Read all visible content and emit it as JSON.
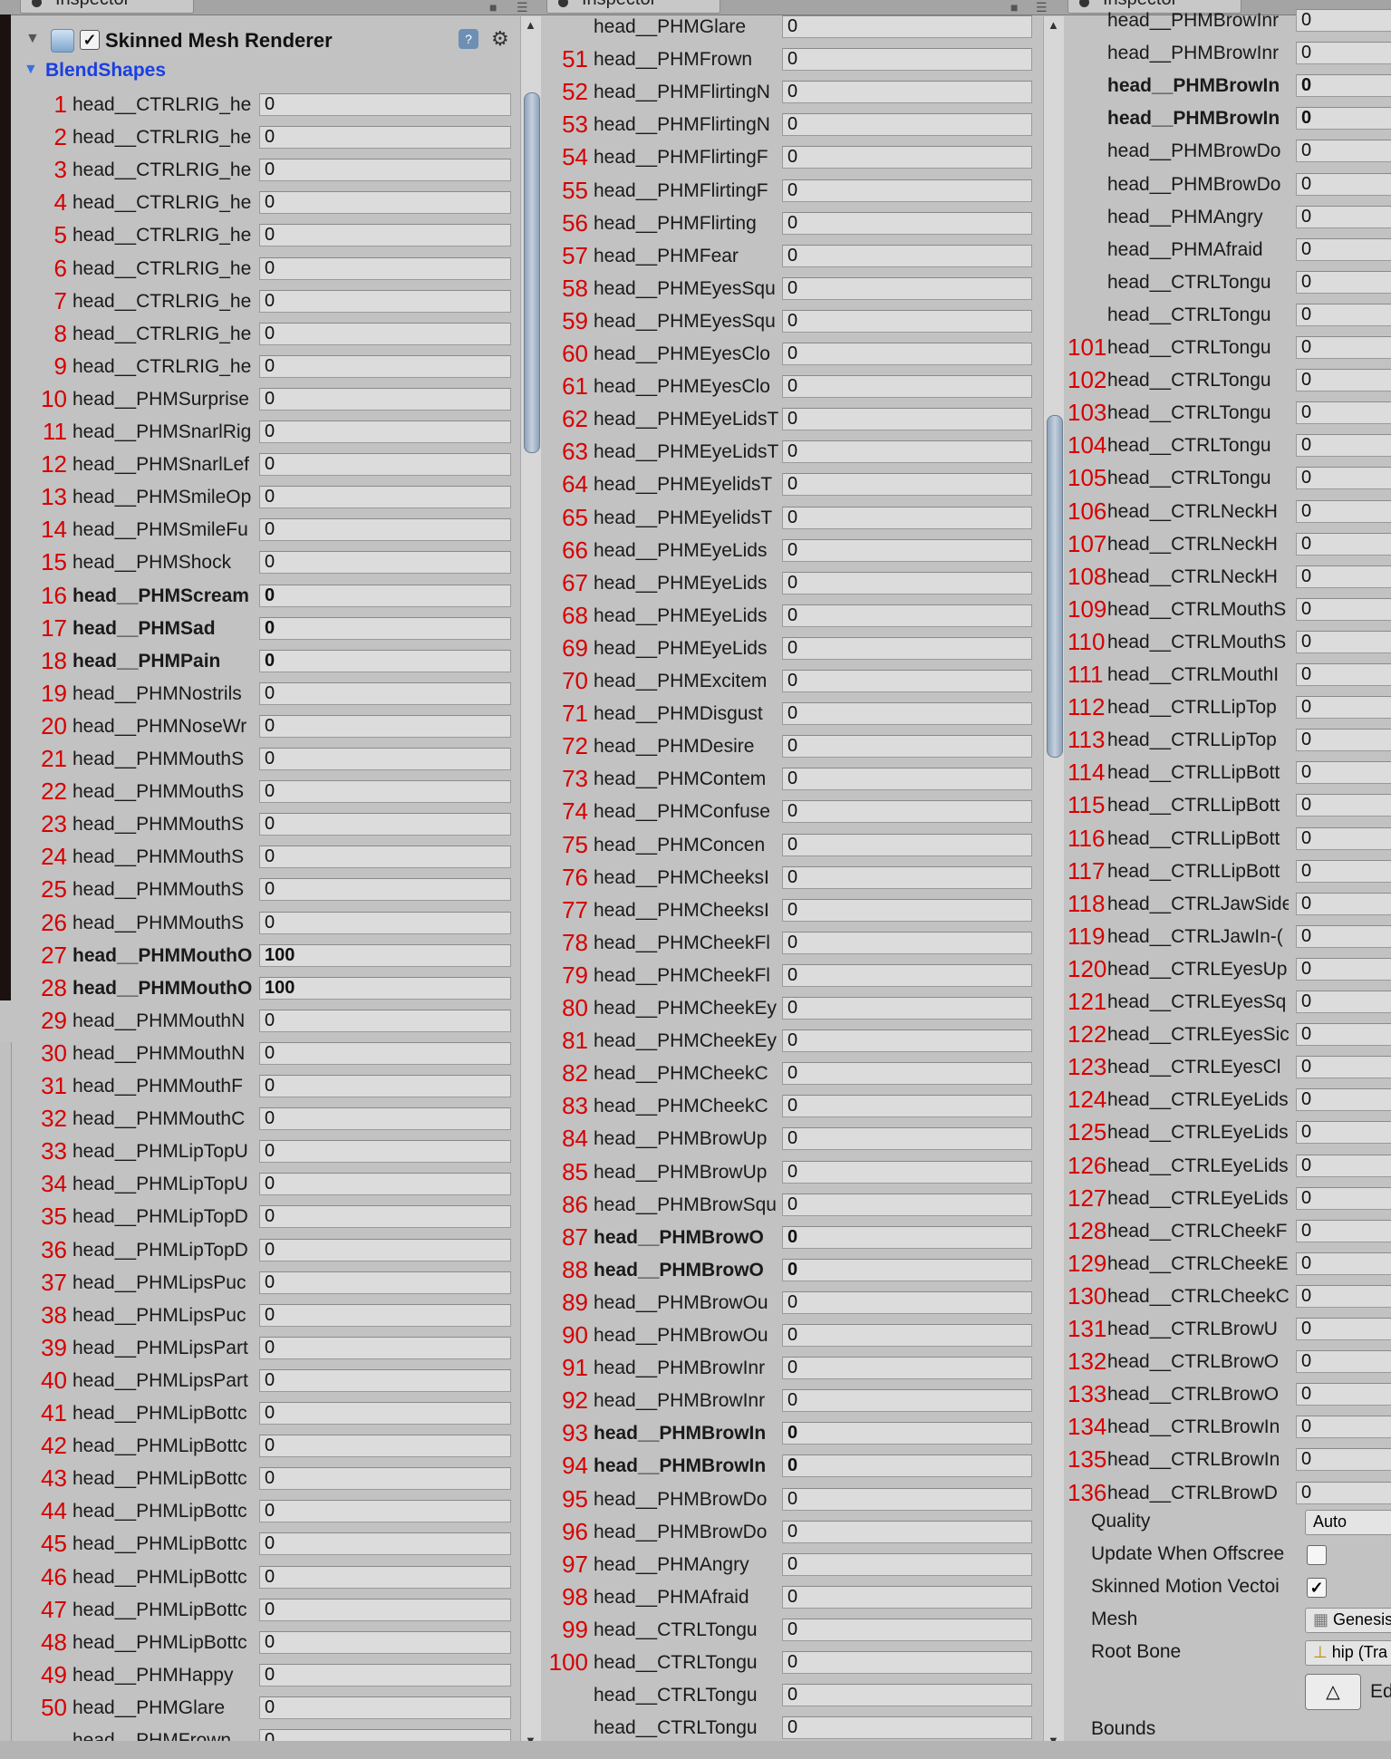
{
  "tabs": [
    "Inspector",
    "Inspector",
    "Inspector"
  ],
  "component": {
    "title": "Skinned Mesh Renderer",
    "enabled": "✓",
    "help": "?",
    "settings": "⚙"
  },
  "blendshapes_label": "BlendShapes",
  "panel1": {
    "rows": [
      {
        "n": "1",
        "label": "head__CTRLRIG_he",
        "value": "0"
      },
      {
        "n": "2",
        "label": "head__CTRLRIG_he",
        "value": "0"
      },
      {
        "n": "3",
        "label": "head__CTRLRIG_he",
        "value": "0"
      },
      {
        "n": "4",
        "label": "head__CTRLRIG_he",
        "value": "0"
      },
      {
        "n": "5",
        "label": "head__CTRLRIG_he",
        "value": "0"
      },
      {
        "n": "6",
        "label": "head__CTRLRIG_he",
        "value": "0"
      },
      {
        "n": "7",
        "label": "head__CTRLRIG_he",
        "value": "0"
      },
      {
        "n": "8",
        "label": "head__CTRLRIG_he",
        "value": "0"
      },
      {
        "n": "9",
        "label": "head__CTRLRIG_he",
        "value": "0"
      },
      {
        "n": "10",
        "label": "head__PHMSurprise",
        "value": "0"
      },
      {
        "n": "11",
        "label": "head__PHMSnarlRig",
        "value": "0"
      },
      {
        "n": "12",
        "label": "head__PHMSnarlLef",
        "value": "0"
      },
      {
        "n": "13",
        "label": "head__PHMSmileOp",
        "value": "0"
      },
      {
        "n": "14",
        "label": "head__PHMSmileFu",
        "value": "0"
      },
      {
        "n": "15",
        "label": "head__PHMShock",
        "value": "0"
      },
      {
        "n": "16",
        "label": "head__PHMScream",
        "value": "0",
        "bold": true
      },
      {
        "n": "17",
        "label": "head__PHMSad",
        "value": "0",
        "bold": true
      },
      {
        "n": "18",
        "label": "head__PHMPain",
        "value": "0",
        "bold": true
      },
      {
        "n": "19",
        "label": "head__PHMNostrils",
        "value": "0"
      },
      {
        "n": "20",
        "label": "head__PHMNoseWr",
        "value": "0"
      },
      {
        "n": "21",
        "label": "head__PHMMouthS",
        "value": "0"
      },
      {
        "n": "22",
        "label": "head__PHMMouthS",
        "value": "0"
      },
      {
        "n": "23",
        "label": "head__PHMMouthS",
        "value": "0"
      },
      {
        "n": "24",
        "label": "head__PHMMouthS",
        "value": "0"
      },
      {
        "n": "25",
        "label": "head__PHMMouthS",
        "value": "0"
      },
      {
        "n": "26",
        "label": "head__PHMMouthS",
        "value": "0"
      },
      {
        "n": "27",
        "label": "head__PHMMouthO",
        "value": "100",
        "bold": true
      },
      {
        "n": "28",
        "label": "head__PHMMouthO",
        "value": "100",
        "bold": true
      },
      {
        "n": "29",
        "label": "head__PHMMouthN",
        "value": "0"
      },
      {
        "n": "30",
        "label": "head__PHMMouthN",
        "value": "0"
      },
      {
        "n": "31",
        "label": "head__PHMMouthF",
        "value": "0"
      },
      {
        "n": "32",
        "label": "head__PHMMouthC",
        "value": "0"
      },
      {
        "n": "33",
        "label": "head__PHMLipTopU",
        "value": "0"
      },
      {
        "n": "34",
        "label": "head__PHMLipTopU",
        "value": "0"
      },
      {
        "n": "35",
        "label": "head__PHMLipTopD",
        "value": "0"
      },
      {
        "n": "36",
        "label": "head__PHMLipTopD",
        "value": "0"
      },
      {
        "n": "37",
        "label": "head__PHMLipsPuc",
        "value": "0"
      },
      {
        "n": "38",
        "label": "head__PHMLipsPuc",
        "value": "0"
      },
      {
        "n": "39",
        "label": "head__PHMLipsPart",
        "value": "0"
      },
      {
        "n": "40",
        "label": "head__PHMLipsPart",
        "value": "0"
      },
      {
        "n": "41",
        "label": "head__PHMLipBottc",
        "value": "0"
      },
      {
        "n": "42",
        "label": "head__PHMLipBottc",
        "value": "0"
      },
      {
        "n": "43",
        "label": "head__PHMLipBottc",
        "value": "0"
      },
      {
        "n": "44",
        "label": "head__PHMLipBottc",
        "value": "0"
      },
      {
        "n": "45",
        "label": "head__PHMLipBottc",
        "value": "0"
      },
      {
        "n": "46",
        "label": "head__PHMLipBottc",
        "value": "0"
      },
      {
        "n": "47",
        "label": "head__PHMLipBottc",
        "value": "0"
      },
      {
        "n": "48",
        "label": "head__PHMLipBottc",
        "value": "0"
      },
      {
        "n": "49",
        "label": "head__PHMHappy",
        "value": "0"
      },
      {
        "n": "50",
        "label": "head__PHMGlare",
        "value": "0"
      },
      {
        "n": "",
        "label": "head__PHMFrown",
        "value": "0"
      }
    ]
  },
  "panel2": {
    "rows": [
      {
        "n": "",
        "label": "head__PHMGlare",
        "value": "0"
      },
      {
        "n": "51",
        "label": "head__PHMFrown",
        "value": "0"
      },
      {
        "n": "52",
        "label": "head__PHMFlirtingN",
        "value": "0"
      },
      {
        "n": "53",
        "label": "head__PHMFlirtingN",
        "value": "0"
      },
      {
        "n": "54",
        "label": "head__PHMFlirtingF",
        "value": "0"
      },
      {
        "n": "55",
        "label": "head__PHMFlirtingF",
        "value": "0"
      },
      {
        "n": "56",
        "label": "head__PHMFlirting",
        "value": "0"
      },
      {
        "n": "57",
        "label": "head__PHMFear",
        "value": "0"
      },
      {
        "n": "58",
        "label": "head__PHMEyesSqu",
        "value": "0"
      },
      {
        "n": "59",
        "label": "head__PHMEyesSqu",
        "value": "0"
      },
      {
        "n": "60",
        "label": "head__PHMEyesClo",
        "value": "0"
      },
      {
        "n": "61",
        "label": "head__PHMEyesClo",
        "value": "0"
      },
      {
        "n": "62",
        "label": "head__PHMEyeLidsT",
        "value": "0"
      },
      {
        "n": "63",
        "label": "head__PHMEyeLidsT",
        "value": "0"
      },
      {
        "n": "64",
        "label": "head__PHMEyelidsT",
        "value": "0"
      },
      {
        "n": "65",
        "label": "head__PHMEyelidsT",
        "value": "0"
      },
      {
        "n": "66",
        "label": "head__PHMEyeLids",
        "value": "0"
      },
      {
        "n": "67",
        "label": "head__PHMEyeLids",
        "value": "0"
      },
      {
        "n": "68",
        "label": "head__PHMEyeLids",
        "value": "0"
      },
      {
        "n": "69",
        "label": "head__PHMEyeLids",
        "value": "0"
      },
      {
        "n": "70",
        "label": "head__PHMExcitem",
        "value": "0"
      },
      {
        "n": "71",
        "label": "head__PHMDisgust",
        "value": "0"
      },
      {
        "n": "72",
        "label": "head__PHMDesire",
        "value": "0"
      },
      {
        "n": "73",
        "label": "head__PHMContem",
        "value": "0"
      },
      {
        "n": "74",
        "label": "head__PHMConfuse",
        "value": "0"
      },
      {
        "n": "75",
        "label": "head__PHMConcen",
        "value": "0"
      },
      {
        "n": "76",
        "label": "head__PHMCheeksI",
        "value": "0"
      },
      {
        "n": "77",
        "label": "head__PHMCheeksI",
        "value": "0"
      },
      {
        "n": "78",
        "label": "head__PHMCheekFl",
        "value": "0"
      },
      {
        "n": "79",
        "label": "head__PHMCheekFl",
        "value": "0"
      },
      {
        "n": "80",
        "label": "head__PHMCheekEy",
        "value": "0"
      },
      {
        "n": "81",
        "label": "head__PHMCheekEy",
        "value": "0"
      },
      {
        "n": "82",
        "label": "head__PHMCheekC",
        "value": "0"
      },
      {
        "n": "83",
        "label": "head__PHMCheekC",
        "value": "0"
      },
      {
        "n": "84",
        "label": "head__PHMBrowUp",
        "value": "0"
      },
      {
        "n": "85",
        "label": "head__PHMBrowUp",
        "value": "0"
      },
      {
        "n": "86",
        "label": "head__PHMBrowSqu",
        "value": "0"
      },
      {
        "n": "87",
        "label": "head__PHMBrowO",
        "value": "0",
        "bold": true
      },
      {
        "n": "88",
        "label": "head__PHMBrowO",
        "value": "0",
        "bold": true
      },
      {
        "n": "89",
        "label": "head__PHMBrowOu",
        "value": "0"
      },
      {
        "n": "90",
        "label": "head__PHMBrowOu",
        "value": "0"
      },
      {
        "n": "91",
        "label": "head__PHMBrowInr",
        "value": "0"
      },
      {
        "n": "92",
        "label": "head__PHMBrowInr",
        "value": "0"
      },
      {
        "n": "93",
        "label": "head__PHMBrowIn",
        "value": "0",
        "bold": true
      },
      {
        "n": "94",
        "label": "head__PHMBrowIn",
        "value": "0",
        "bold": true
      },
      {
        "n": "95",
        "label": "head__PHMBrowDo",
        "value": "0"
      },
      {
        "n": "96",
        "label": "head__PHMBrowDo",
        "value": "0"
      },
      {
        "n": "97",
        "label": "head__PHMAngry",
        "value": "0"
      },
      {
        "n": "98",
        "label": "head__PHMAfraid",
        "value": "0"
      },
      {
        "n": "99",
        "label": "head__CTRLTongu",
        "value": "0"
      },
      {
        "n": "100",
        "label": "head__CTRLTongu",
        "value": "0"
      },
      {
        "n": "",
        "label": "head__CTRLTongu",
        "value": "0"
      },
      {
        "n": "",
        "label": "head__CTRLTongu",
        "value": "0"
      }
    ]
  },
  "panel3": {
    "rows": [
      {
        "n": "",
        "label": "head__PHMBrowInr",
        "value": "0"
      },
      {
        "n": "",
        "label": "head__PHMBrowInr",
        "value": "0"
      },
      {
        "n": "",
        "label": "head__PHMBrowIn",
        "value": "0",
        "bold": true
      },
      {
        "n": "",
        "label": "head__PHMBrowIn",
        "value": "0",
        "bold": true
      },
      {
        "n": "",
        "label": "head__PHMBrowDo",
        "value": "0"
      },
      {
        "n": "",
        "label": "head__PHMBrowDo",
        "value": "0"
      },
      {
        "n": "",
        "label": "head__PHMAngry",
        "value": "0"
      },
      {
        "n": "",
        "label": "head__PHMAfraid",
        "value": "0"
      },
      {
        "n": "",
        "label": "head__CTRLTongu",
        "value": "0"
      },
      {
        "n": "",
        "label": "head__CTRLTongu",
        "value": "0"
      },
      {
        "n": "101",
        "label": "head__CTRLTongu",
        "value": "0"
      },
      {
        "n": "102",
        "label": "head__CTRLTongu",
        "value": "0"
      },
      {
        "n": "103",
        "label": "head__CTRLTongu",
        "value": "0"
      },
      {
        "n": "104",
        "label": "head__CTRLTongu",
        "value": "0"
      },
      {
        "n": "105",
        "label": "head__CTRLTongu",
        "value": "0"
      },
      {
        "n": "106",
        "label": "head__CTRLNeckH",
        "value": "0"
      },
      {
        "n": "107",
        "label": "head__CTRLNeckH",
        "value": "0"
      },
      {
        "n": "108",
        "label": "head__CTRLNeckH",
        "value": "0"
      },
      {
        "n": "109",
        "label": "head__CTRLMouthS",
        "value": "0"
      },
      {
        "n": "110",
        "label": "head__CTRLMouthS",
        "value": "0"
      },
      {
        "n": "111",
        "label": "head__CTRLMouthI",
        "value": "0"
      },
      {
        "n": "112",
        "label": "head__CTRLLipTop",
        "value": "0"
      },
      {
        "n": "113",
        "label": "head__CTRLLipTop",
        "value": "0"
      },
      {
        "n": "114",
        "label": "head__CTRLLipBott",
        "value": "0"
      },
      {
        "n": "115",
        "label": "head__CTRLLipBott",
        "value": "0"
      },
      {
        "n": "116",
        "label": "head__CTRLLipBott",
        "value": "0"
      },
      {
        "n": "117",
        "label": "head__CTRLLipBott",
        "value": "0"
      },
      {
        "n": "118",
        "label": "head__CTRLJawSide",
        "value": "0"
      },
      {
        "n": "119",
        "label": "head__CTRLJawIn-(",
        "value": "0"
      },
      {
        "n": "120",
        "label": "head__CTRLEyesUp",
        "value": "0"
      },
      {
        "n": "121",
        "label": "head__CTRLEyesSq",
        "value": "0"
      },
      {
        "n": "122",
        "label": "head__CTRLEyesSic",
        "value": "0"
      },
      {
        "n": "123",
        "label": "head__CTRLEyesCl",
        "value": "0"
      },
      {
        "n": "124",
        "label": "head__CTRLEyeLids",
        "value": "0"
      },
      {
        "n": "125",
        "label": "head__CTRLEyeLids",
        "value": "0"
      },
      {
        "n": "126",
        "label": "head__CTRLEyeLids",
        "value": "0"
      },
      {
        "n": "127",
        "label": "head__CTRLEyeLids",
        "value": "0"
      },
      {
        "n": "128",
        "label": "head__CTRLCheekF",
        "value": "0"
      },
      {
        "n": "129",
        "label": "head__CTRLCheekE",
        "value": "0"
      },
      {
        "n": "130",
        "label": "head__CTRLCheekC",
        "value": "0"
      },
      {
        "n": "131",
        "label": "head__CTRLBrowU",
        "value": "0"
      },
      {
        "n": "132",
        "label": "head__CTRLBrowO",
        "value": "0"
      },
      {
        "n": "133",
        "label": "head__CTRLBrowO",
        "value": "0"
      },
      {
        "n": "134",
        "label": "head__CTRLBrowIn",
        "value": "0"
      },
      {
        "n": "135",
        "label": "head__CTRLBrowIn",
        "value": "0"
      },
      {
        "n": "136",
        "label": "head__CTRLBrowD",
        "value": "0"
      }
    ],
    "props": {
      "quality_label": "Quality",
      "quality_value": "Auto",
      "offscreen_label": "Update When Offscree",
      "motion_label": "Skinned Motion Vectoi",
      "motion_value": "✓",
      "mesh_label": "Mesh",
      "mesh_value": "Genesis",
      "rootbone_label": "Root Bone",
      "rootbone_value": "hip (Tra",
      "edit_label": "Ed",
      "bounds_label": "Bounds"
    }
  }
}
